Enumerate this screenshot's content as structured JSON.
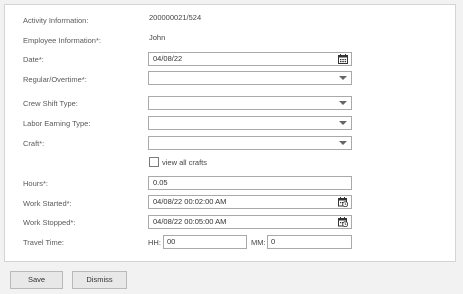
{
  "form": {
    "activity_label": "Activity Information:",
    "activity_value": "200000021/524",
    "employee_label": "Employee Information*:",
    "employee_value": "John",
    "date_label": "Date*:",
    "date_value": "04/08/22",
    "regular_overtime_label": "Regular/Overtime*:",
    "regular_overtime_value": "",
    "crew_shift_label": "Crew Shift Type:",
    "crew_shift_value": "",
    "labor_earning_label": "Labor Earning Type:",
    "labor_earning_value": "",
    "craft_label": "Craft*:",
    "craft_value": "",
    "view_all_crafts_label": "view all crafts",
    "hours_label": "Hours*:",
    "hours_value": "0.05",
    "work_started_label": "Work Started*:",
    "work_started_value": "04/08/22 00:02:00 AM",
    "work_stopped_label": "Work Stopped*:",
    "work_stopped_value": "04/08/22 00:05:00 AM",
    "travel_time_label": "Travel Time:",
    "hh_label": "HH:",
    "hh_value": "00",
    "mm_label": "MM:",
    "mm_value": "0"
  },
  "buttons": {
    "save_label": "Save",
    "dismiss_label": "Dismiss"
  },
  "icons": {
    "calendar": "calendar-icon",
    "datetime": "calendar-clock-icon",
    "dropdown": "chevron-down-icon"
  }
}
